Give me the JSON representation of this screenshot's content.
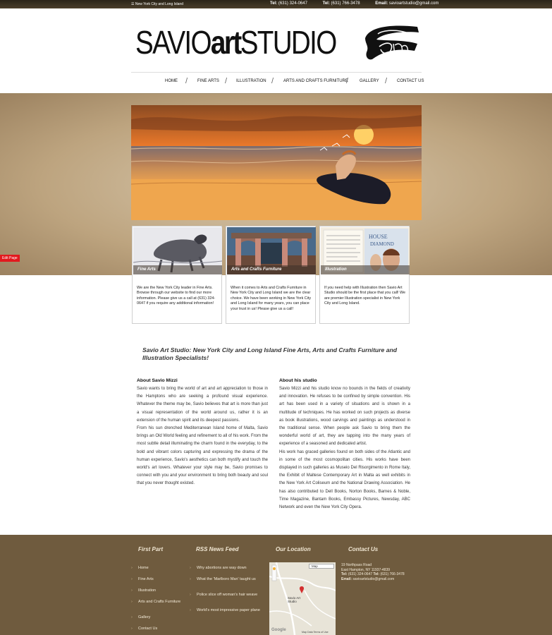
{
  "topbar": {
    "location": "☰ New York City and Long Island",
    "tel1_label": "Tel:",
    "tel1": "(631) 324-0647",
    "tel2_label": "Tel:",
    "tel2": "(631) 766-3478",
    "email_label": "Email:",
    "email": "savioartstudio@gmail.com"
  },
  "logo": {
    "part1": "SAVIO",
    "part2": "art",
    "part3": "STUDIO"
  },
  "nav": [
    "HOME",
    "FINE ARTS",
    "ILLUSTRATION",
    "ARTS AND CRAFTS FURNITURE",
    "GALLERY",
    "CONTACT US"
  ],
  "edit_page": "Edit Page",
  "cards": [
    {
      "caption": "Fine Arts",
      "text": "We are the New York City leader in Fine Arts. Browse through our website to find our more information. Please give us a call at (631) 324-0647 if you require any additional information!"
    },
    {
      "caption": "Arts and Crafts Furniture",
      "text": "When it comes to Arts and Crafts Furniture in New York City and Long Island we are the clear choice. We have been working in New York City and Long Island for many years, you can place your trust in us! Please give us a call!"
    },
    {
      "caption": "Illustration",
      "text": "If you need help with Illustration then Savio Art Studio should be the first place that you call! We are premier Illustration specialist in New York City and Long Island."
    }
  ],
  "headline": "Savio Art Studio: New York City and Long Island Fine Arts, Arts and Crafts Furniture and Illustration Specialists!",
  "about_savio": {
    "title": "About Savio Mizzi",
    "p1": "Savio wants to bring the world of art and art appreciation to those in the Hamptons who are seeking a profound visual experience. Whatever the theme may be, Savio believes that art is more than just a visual representation of the world around us, rather it is an extension of the human spirit and its deepest passions.",
    "p2": "From his sun drenched Mediterranean Island home of Malta, Savio brings an Old World feeling and refinement to all of his work. From the most subtle detail illuminating the charm found in the everyday, to the bold and vibrant colors capturing and expressing the drama of the human experience, Savio's aesthetics can both mystify and touch the world's art lovers. Whatever your style may be, Savio promises to connect with you and your environment to bring both beauty and soul that you never thought existed."
  },
  "about_studio": {
    "title": "About his studio",
    "p1": "Savio Mizzi and his studio know no bounds in the fields of creativity and innovation. He refuses to be confined by simple convention. His art has been used in a variety of situations and is shown in a multitude of techniques. He has worked on such projects as diverse as book illustrations, wood carvings and paintings as understood in the traditional sense. When people ask Savio to bring them the wonderful world of art, they are tapping into the many years of experience of a seasoned and dedicated artist.",
    "p2": "His work has graced galleries found on both sides of the Atlantic and in some of the most cosmopolitan cities. His works have been displayed in such galleries as Museio Del Risorgimento in Rome Italy, the Exhibit of Maltese Contemporary Art in Malta as well exhibits in the New York Art Coliseum and the National Drawing Association. He has also contributed to Dell Books, Norton Books, Barnes & Noble, Time Magazine, Bantam Books, Embassy Pictures, Newsday, ABC Network and even the New York City Opera."
  },
  "footer": {
    "first_part": {
      "heading": "First Part",
      "links": [
        "Home",
        "Fine Arts",
        "Illustration",
        "Arts and Crafts Furniture",
        "Gallery",
        "Contact Us"
      ]
    },
    "rss": {
      "heading": "RSS News Feed",
      "links": [
        "Why abortions are way down",
        "What the 'Marlboro Man' taught us",
        "Police slice off woman's hair weave",
        "World's most impressive paper plane"
      ]
    },
    "location": {
      "heading": "Our Location",
      "map_type": "Map",
      "map_label": "Savio Art Studio",
      "google": "Google",
      "map_footer": "Map Data  Terms of Use"
    },
    "contact": {
      "heading": "Contact Us",
      "address1": "19 Northpass Road",
      "address2": "East Hampton, NY 11937-4839",
      "tel_label": "Tel:",
      "tel1": "(631) 324-0647",
      "tel2_label": "Tel:",
      "tel2": "(631) 766-3478",
      "email_label": "Email:",
      "email": "savioartstudio@gmail.com"
    }
  },
  "colors": {
    "footer": "#6f5b3e",
    "edit_page": "#e2191e",
    "topbar": "#3a3020"
  }
}
